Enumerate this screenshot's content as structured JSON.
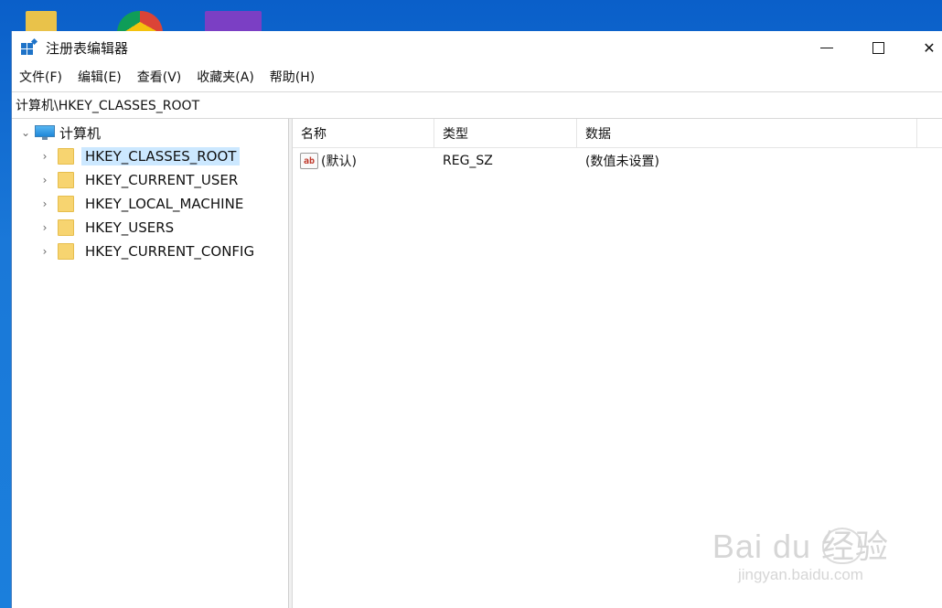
{
  "window": {
    "title": "注册表编辑器",
    "controls": {
      "minimize": "",
      "maximize": "",
      "close": "✕"
    }
  },
  "menu": {
    "items": [
      {
        "label": "文件(F)"
      },
      {
        "label": "编辑(E)"
      },
      {
        "label": "查看(V)"
      },
      {
        "label": "收藏夹(A)"
      },
      {
        "label": "帮助(H)"
      }
    ]
  },
  "address": {
    "path": "计算机\\HKEY_CLASSES_ROOT"
  },
  "tree": {
    "root_label": "计算机",
    "keys": [
      {
        "label": "HKEY_CLASSES_ROOT",
        "selected": true
      },
      {
        "label": "HKEY_CURRENT_USER"
      },
      {
        "label": "HKEY_LOCAL_MACHINE"
      },
      {
        "label": "HKEY_USERS"
      },
      {
        "label": "HKEY_CURRENT_CONFIG"
      }
    ]
  },
  "list": {
    "headers": {
      "name": "名称",
      "type": "类型",
      "data": "数据"
    },
    "rows": [
      {
        "icon": "ab",
        "name": "(默认)",
        "type": "REG_SZ",
        "data": "(数值未设置)"
      }
    ]
  },
  "watermark": {
    "logo": "Bai du 经验",
    "url": "jingyan.baidu.com"
  }
}
